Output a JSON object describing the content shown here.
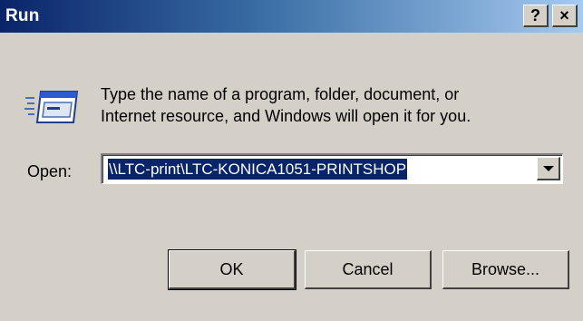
{
  "window": {
    "title": "Run",
    "help_button": "?",
    "close_button": "×"
  },
  "description": {
    "line1": "Type the name of a program, folder, document, or",
    "line2": "Internet resource, and Windows will open it for you."
  },
  "open_field": {
    "label": "Open:",
    "value": "\\\\LTC-print\\LTC-KONICA1051-PRINTSHOP"
  },
  "buttons": {
    "ok": "OK",
    "cancel": "Cancel",
    "browse": "Browse..."
  },
  "icons": {
    "run_icon": "run-program-icon",
    "dropdown": "chevron-down-icon"
  },
  "colors": {
    "title_bar_start": "#0a246a",
    "title_bar_end": "#a6caf0",
    "dialog_background": "#d4d0c8",
    "selection": "#0a246a"
  }
}
